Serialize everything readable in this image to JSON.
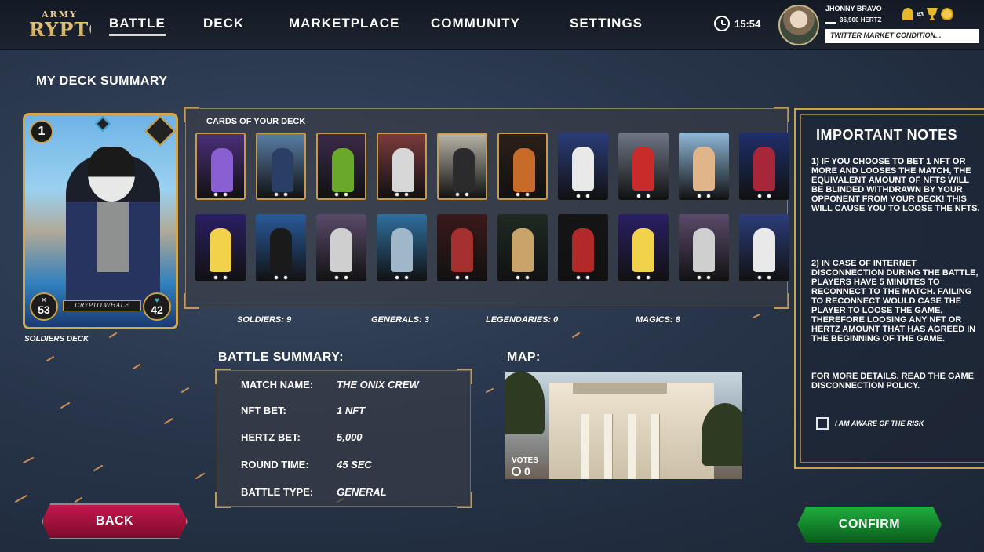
{
  "brand": {
    "logo_line1": "ARMY",
    "logo_line2": "CRYPTO"
  },
  "nav": {
    "items": [
      {
        "label": "BATTLE",
        "active": true
      },
      {
        "label": "DECK",
        "active": false
      },
      {
        "label": "MARKETPLACE",
        "active": false
      },
      {
        "label": "COMMUNITY",
        "active": false
      },
      {
        "label": "SETTINGS",
        "active": false
      }
    ]
  },
  "header": {
    "time": "15:54",
    "player_name": "JHONNY BRAVO",
    "hertz": "36,900 HERTZ",
    "rank": "#3",
    "ticker": "TWITTER MARKET CONDITION..."
  },
  "page_title": "MY DECK SUMMARY",
  "leader_card": {
    "level": "1",
    "name": "CRYPTO WHALE",
    "attack": "53",
    "defense": "42",
    "deck_label": "SOLDIERS DECK"
  },
  "deck_panel": {
    "label": "CARDS OF YOUR DECK",
    "cards": [
      {
        "icon": "wizard-card",
        "framed": true,
        "bg": "#4b2f7a",
        "fg": "#8a5fd1"
      },
      {
        "icon": "suit-man-card",
        "framed": true,
        "bg": "#5a7ea6",
        "fg": "#2a3f63"
      },
      {
        "icon": "joker-card",
        "framed": true,
        "bg": "#3b2a4a",
        "fg": "#6aa82b"
      },
      {
        "icon": "king-card",
        "framed": true,
        "bg": "#7a3b3b",
        "fg": "#d7d7d7"
      },
      {
        "icon": "group-card",
        "framed": true,
        "bg": "#b8b2a6",
        "fg": "#2b2b2b"
      },
      {
        "icon": "monk-card",
        "framed": true,
        "bg": "#2b2018",
        "fg": "#c76b2a"
      },
      {
        "icon": "scientist-card",
        "framed": false,
        "bg": "#2b3d7a",
        "fg": "#e9e9e9"
      },
      {
        "icon": "runner-card",
        "framed": false,
        "bg": "#6f7785",
        "fg": "#c92a2a"
      },
      {
        "icon": "fighter-card",
        "framed": false,
        "bg": "#8fb8d8",
        "fg": "#e1b58a"
      },
      {
        "icon": "lama-card",
        "framed": false,
        "bg": "#1f2f6a",
        "fg": "#a8263a"
      },
      {
        "icon": "worker-card",
        "framed": false,
        "bg": "#2a1f63",
        "fg": "#f2d24a"
      },
      {
        "icon": "singer-card",
        "framed": false,
        "bg": "#2a5a9a",
        "fg": "#1a1a1a"
      },
      {
        "icon": "boxer-card",
        "framed": false,
        "bg": "#5a4a6a",
        "fg": "#cfcfcf"
      },
      {
        "icon": "shark-card",
        "framed": false,
        "bg": "#2f6f9f",
        "fg": "#9fb7c9"
      },
      {
        "icon": "sorcerer-card",
        "framed": false,
        "bg": "#3a1a1a",
        "fg": "#a43030"
      },
      {
        "icon": "warrior-card",
        "framed": false,
        "bg": "#1e2a22",
        "fg": "#c9a46a"
      },
      {
        "icon": "saber-card",
        "framed": false,
        "bg": "#151515",
        "fg": "#b02a2a"
      },
      {
        "icon": "worker-card",
        "framed": false,
        "bg": "#2a1f63",
        "fg": "#f2d24a"
      },
      {
        "icon": "boxer-card",
        "framed": false,
        "bg": "#5a4a6a",
        "fg": "#cfcfcf"
      },
      {
        "icon": "scientist-card",
        "framed": false,
        "bg": "#2b3d7a",
        "fg": "#e9e9e9"
      }
    ]
  },
  "counts": {
    "soldiers": "SOLDIERS: 9",
    "generals": "GENERALS: 3",
    "legendaries": "LEGENDARIES: 0",
    "magics": "MAGICS: 8"
  },
  "battle_summary": {
    "title": "BATTLE SUMMARY:",
    "rows": [
      {
        "label": "MATCH NAME:",
        "value": "THE ONIX CREW"
      },
      {
        "label": "NFT BET:",
        "value": "1 NFT"
      },
      {
        "label": "HERTZ BET:",
        "value": "5,000"
      },
      {
        "label": "ROUND TIME:",
        "value": "45 SEC"
      },
      {
        "label": "BATTLE TYPE:",
        "value": "GENERAL"
      }
    ]
  },
  "map": {
    "title": "MAP:",
    "votes_label": "VOTES",
    "votes_count": "0"
  },
  "notes": {
    "title": "IMPORTANT NOTES",
    "note1": "1) IF YOU CHOOSE TO BET 1 NFT OR MORE AND LOOSES THE MATCH, THE EQUIVALENT AMOUNT OF NFTS WILL BE BLINDED WITHDRAWN BY YOUR OPPONENT FROM YOUR DECK! THIS WILL CAUSE YOU TO LOOSE THE NFTS.",
    "note2": "2) IN CASE OF INTERNET DISCONNECTION DURING THE BATTLE, PLAYERS HAVE 5 MINUTES TO RECONNECT TO THE MATCH.  FAILING TO RECONNECT WOULD CASE THE PLAYER TO LOOSE THE GAME, THEREFORE LOOSING ANY NFT OR HERTZ AMOUNT THAT HAS AGREED IN THE BEGINNING OF THE GAME.",
    "note3": "FOR MORE DETAILS, READ THE GAME DISCONNECTION POLICY.",
    "risk_label": "I AM AWARE OF THE RISK"
  },
  "buttons": {
    "back": "BACK",
    "confirm": "CONFIRM"
  },
  "colors": {
    "back": "#c6194f",
    "confirm": "#1fae3e",
    "gold": "#c9a24c"
  }
}
